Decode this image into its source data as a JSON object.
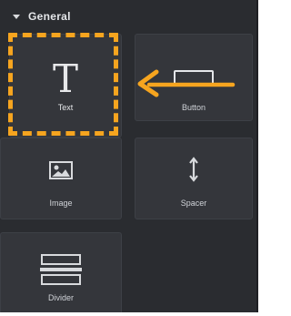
{
  "section": {
    "title": "General",
    "toggle_icon": "caret-down-icon"
  },
  "widgets": [
    {
      "label": "Text",
      "icon": "text-icon"
    },
    {
      "label": "Button",
      "icon": "button-icon"
    },
    {
      "label": "Image",
      "icon": "image-icon"
    },
    {
      "label": "Spacer",
      "icon": "spacer-icon"
    },
    {
      "label": "Divider",
      "icon": "divider-icon"
    }
  ],
  "annotations": {
    "highlight_color": "#f6a51f",
    "arrow_color": "#f6a51f",
    "text_icon_glyph": "T"
  },
  "colors": {
    "panel_bg": "#2a2c30",
    "widget_bg": "#34363b",
    "label": "#d0d3d8"
  }
}
